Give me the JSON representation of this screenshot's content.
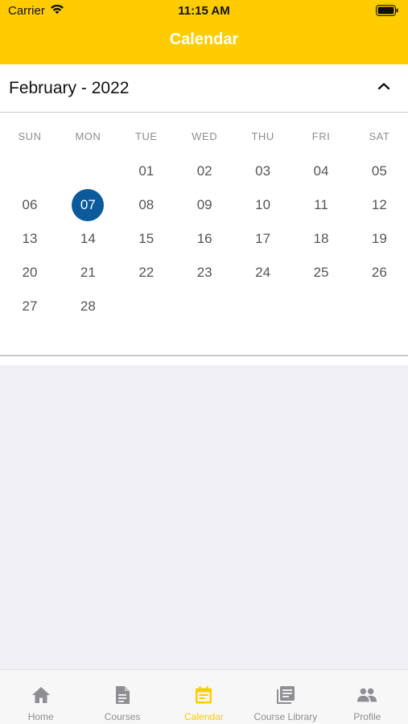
{
  "status_bar": {
    "carrier": "Carrier",
    "time": "11:15 AM",
    "wifi_icon": "wifi-icon",
    "battery_icon": "battery-icon"
  },
  "header": {
    "title": "Calendar"
  },
  "month_bar": {
    "label": "February - 2022",
    "collapse_icon": "chevron-up-icon"
  },
  "calendar": {
    "weekdays": [
      "SUN",
      "MON",
      "TUE",
      "WED",
      "THU",
      "FRI",
      "SAT"
    ],
    "weeks": [
      [
        "",
        "",
        "01",
        "02",
        "03",
        "04",
        "05"
      ],
      [
        "06",
        "07",
        "08",
        "09",
        "10",
        "11",
        "12"
      ],
      [
        "13",
        "14",
        "15",
        "16",
        "17",
        "18",
        "19"
      ],
      [
        "20",
        "21",
        "22",
        "23",
        "24",
        "25",
        "26"
      ],
      [
        "27",
        "28",
        "",
        "",
        "",
        "",
        ""
      ]
    ],
    "selected_day": "07",
    "selected_color": "#0a5a9c"
  },
  "tabs": [
    {
      "label": "Home",
      "icon": "home-icon",
      "active": false
    },
    {
      "label": "Courses",
      "icon": "document-icon",
      "active": false
    },
    {
      "label": "Calendar",
      "icon": "calendar-icon",
      "active": true
    },
    {
      "label": "Course Library",
      "icon": "library-icon",
      "active": false
    },
    {
      "label": "Profile",
      "icon": "people-icon",
      "active": false
    }
  ],
  "colors": {
    "brand": "#ffcc00",
    "tab_inactive": "#8e8e93",
    "background": "#efeff4"
  }
}
